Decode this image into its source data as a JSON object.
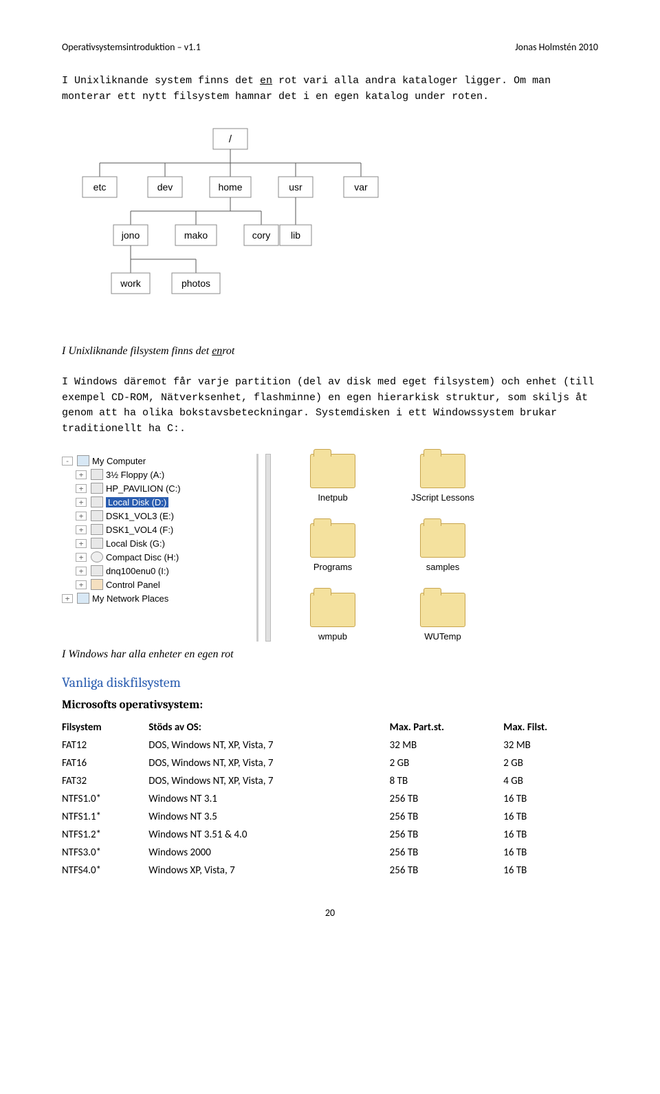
{
  "header": {
    "left": "Operativsystemsintroduktion – v1.1",
    "right": "Jonas Holmstén 2010"
  },
  "intro": {
    "part1": "I Unixliknande system finns det ",
    "underlined1": "en",
    "part2": " rot vari alla andra kataloger ligger. Om man monterar ett nytt filsystem hamnar det i en egen katalog under roten."
  },
  "unix_tree": {
    "root": "/",
    "row1": [
      "etc",
      "dev",
      "home",
      "usr",
      "var"
    ],
    "row2": [
      "jono",
      "mako",
      "cory",
      "lib"
    ],
    "row3": [
      "work",
      "photos"
    ]
  },
  "caption_unix": {
    "pre": "I Unixliknande filsystem finns det ",
    "u": "en",
    "post": "rot"
  },
  "mid_text": "I Windows däremot får varje partition (del av disk med eget filsystem) och enhet (till exempel CD-ROM, Nätverksenhet, flashminne) en egen hierarkisk struktur, som skiljs åt genom att ha olika bokstavsbeteckningar. Systemdisken i ett Windowssystem brukar traditionellt ha C:.",
  "explorer_tree": [
    {
      "icon": "computer",
      "indent": 0,
      "expand": "-",
      "label": "My Computer"
    },
    {
      "icon": "drive",
      "indent": 1,
      "expand": "+",
      "label": "3½ Floppy (A:)"
    },
    {
      "icon": "drive",
      "indent": 1,
      "expand": "+",
      "label": "HP_PAVILION (C:)"
    },
    {
      "icon": "drive",
      "indent": 1,
      "expand": "+",
      "label": "Local Disk (D:)",
      "selected": true
    },
    {
      "icon": "drive",
      "indent": 1,
      "expand": "+",
      "label": "DSK1_VOL3 (E:)"
    },
    {
      "icon": "drive",
      "indent": 1,
      "expand": "+",
      "label": "DSK1_VOL4 (F:)"
    },
    {
      "icon": "drive",
      "indent": 1,
      "expand": "+",
      "label": "Local Disk (G:)"
    },
    {
      "icon": "cd",
      "indent": 1,
      "expand": "+",
      "label": "Compact Disc (H:)"
    },
    {
      "icon": "drive",
      "indent": 1,
      "expand": "+",
      "label": "dnq100enu0 (I:)"
    },
    {
      "icon": "panel",
      "indent": 1,
      "expand": "+",
      "label": "Control Panel"
    },
    {
      "icon": "computer",
      "indent": 0,
      "expand": "+",
      "label": "My Network Places"
    }
  ],
  "explorer_folders": [
    "Inetpub",
    "JScript Lessons",
    "Programs",
    "samples",
    "wmpub",
    "WUTemp"
  ],
  "caption_win": "I Windows har alla enheter en egen rot",
  "section_title": "Vanliga diskfilsystem",
  "subsection_title": "Microsofts operativsystem:",
  "table": {
    "headers": [
      "Filsystem",
      "Stöds av OS:",
      "Max. Part.st.",
      "Max. Filst."
    ],
    "rows": [
      [
        "FAT12",
        "DOS, Windows NT, XP, Vista, 7",
        "32 MB",
        "32 MB"
      ],
      [
        "FAT16",
        "DOS, Windows NT, XP, Vista, 7",
        "2 GB",
        "2 GB"
      ],
      [
        "FAT32",
        "DOS, Windows NT, XP, Vista, 7",
        "8 TB",
        "4 GB"
      ],
      [
        "NTFS1.0*",
        "Windows NT 3.1",
        "256 TB",
        "16 TB"
      ],
      [
        "NTFS1.1*",
        "Windows NT 3.5",
        "256 TB",
        "16 TB"
      ],
      [
        "NTFS1.2*",
        "Windows NT 3.51 & 4.0",
        "256 TB",
        "16 TB"
      ],
      [
        "NTFS3.0*",
        "Windows 2000",
        "256 TB",
        "16 TB"
      ],
      [
        "NTFS4.0*",
        "Windows XP, Vista, 7",
        "256 TB",
        "16 TB"
      ]
    ]
  },
  "page_number": "20"
}
